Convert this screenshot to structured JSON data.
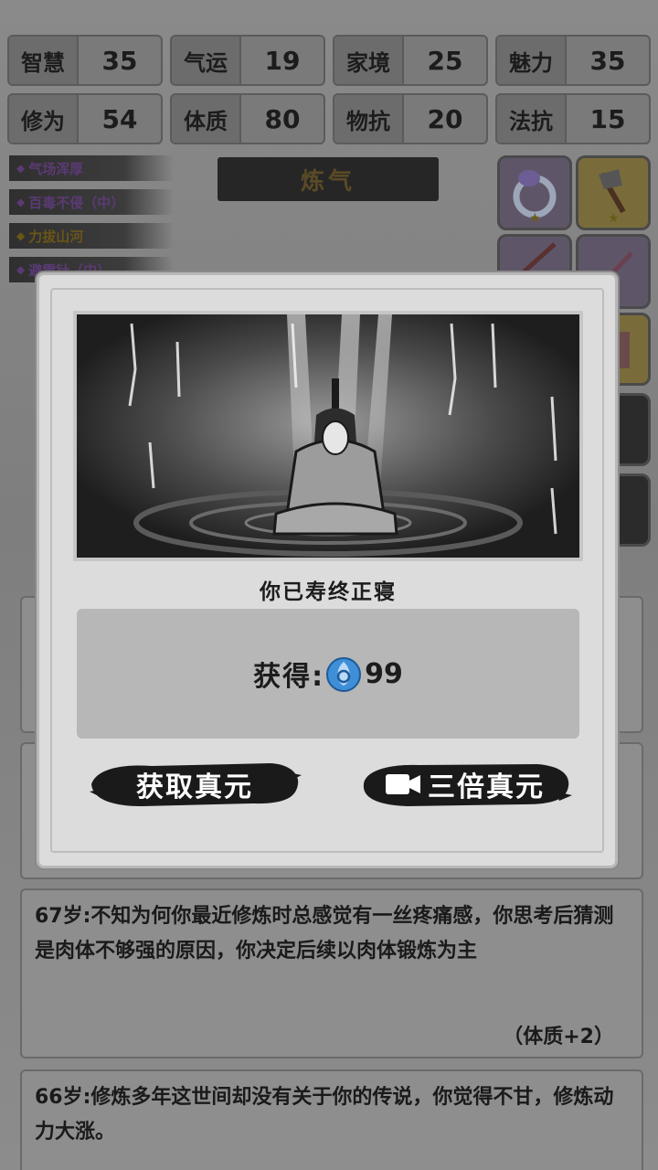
{
  "stats": [
    {
      "label": "智慧",
      "value": "35"
    },
    {
      "label": "气运",
      "value": "19"
    },
    {
      "label": "家境",
      "value": "25"
    },
    {
      "label": "魅力",
      "value": "35"
    },
    {
      "label": "修为",
      "value": "54"
    },
    {
      "label": "体质",
      "value": "80"
    },
    {
      "label": "物抗",
      "value": "20"
    },
    {
      "label": "法抗",
      "value": "15"
    }
  ],
  "buffs": [
    {
      "label": "气场浑厚",
      "color": "purple"
    },
    {
      "label": "百毒不侵（中）",
      "color": "purple"
    },
    {
      "label": "力拔山河",
      "color": "gold"
    },
    {
      "label": "避雷针（中）",
      "color": "purple"
    }
  ],
  "realm": "炼气",
  "logs": [
    {
      "age": "67岁:",
      "text": "不知为何你最近修炼时总感觉有一丝疼痛感，你思考后猜测是肉体不够强的原因，你决定后续以肉体锻炼为主",
      "effect": "（体质+2）"
    },
    {
      "age": "66岁:",
      "text": "修炼多年这世间却没有关于你的传说，你觉得不甘，修炼动力大涨。",
      "effect": ""
    }
  ],
  "modal": {
    "result": "你已寿终正寝",
    "reward_label": "获得:",
    "reward_amount": "99",
    "reward_icon": "spirit-essence-icon",
    "btn_collect": "获取真元",
    "btn_triple": "三倍真元"
  },
  "colors": {
    "modal_bg": "#dcdcdc",
    "reward_box": "#b7b7b7",
    "brush_black": "#1a1a1a",
    "reward_blue": "#3f8fd8"
  }
}
